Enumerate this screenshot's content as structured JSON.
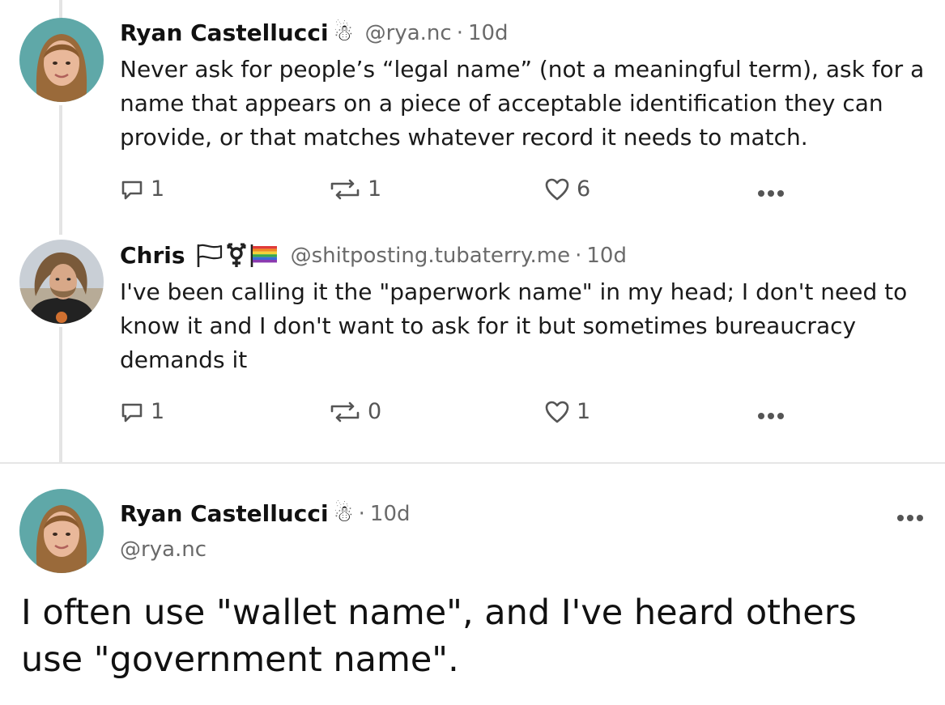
{
  "posts": [
    {
      "author": "Ryan Castellucci",
      "badge": "☃",
      "handle": "@rya.nc",
      "sep": "·",
      "time": "10d",
      "text": "Never ask for people’s “legal name” (not a meaningful term), ask for a name that appears on a piece of acceptable identification they can provide, or that matches whatever record it needs to match.",
      "replies": "1",
      "reposts": "1",
      "likes": "6"
    },
    {
      "author": "Chris",
      "flags": [
        "white-flag-icon",
        "transgender-symbol-icon",
        "rainbow-flag-icon"
      ],
      "handle": "@shitposting.tubaterry.me",
      "sep": "·",
      "time": "10d",
      "text": "I've been calling it the \"paperwork name\" in my head; I don't need to know it and I don't want to ask for it but sometimes bureaucracy demands it",
      "replies": "1",
      "reposts": "0",
      "likes": "1"
    }
  ],
  "main_post": {
    "author": "Ryan Castellucci",
    "badge": "☃",
    "sep": "·",
    "time": "10d",
    "handle": "@rya.nc",
    "text": "I often use \"wallet name\", and I've heard others use \"government name\"."
  },
  "icons": {
    "reply": "speech-bubble-icon",
    "repost": "repost-arrows-icon",
    "like": "heart-icon",
    "more": "ellipsis-icon"
  },
  "colors": {
    "text": "#1a1a1a",
    "muted": "#6a6a6a",
    "icon": "#555555",
    "thread_line": "#e4e4e4",
    "avatar_bg": "#5fa8a8"
  }
}
